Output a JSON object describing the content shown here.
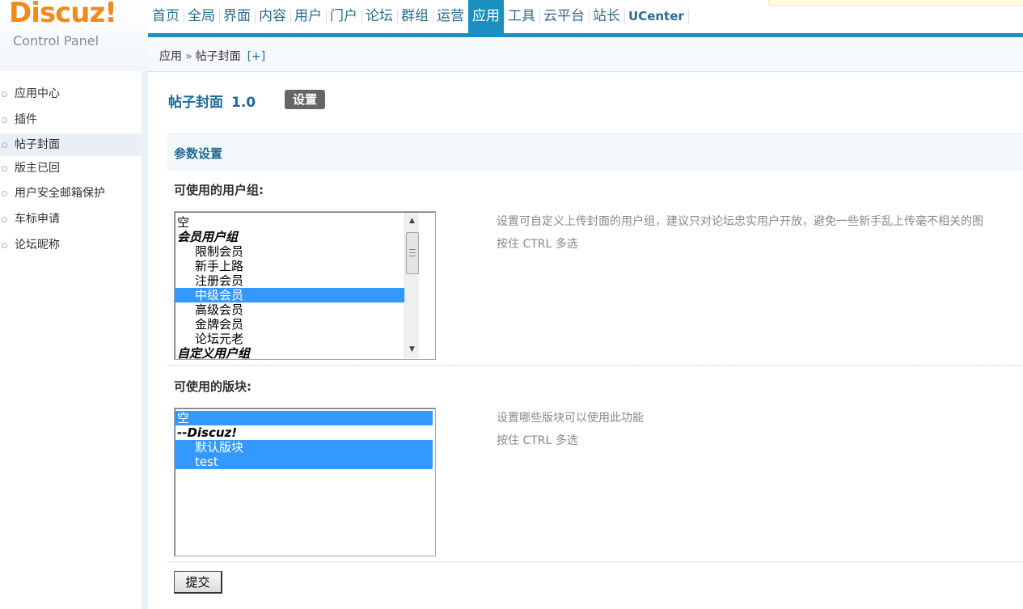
{
  "logo": {
    "brand": "Discuz",
    "bang": "!",
    "subtitle": "Control Panel"
  },
  "topnav": {
    "items": [
      {
        "label": "首页"
      },
      {
        "label": "全局"
      },
      {
        "label": "界面"
      },
      {
        "label": "内容"
      },
      {
        "label": "用户"
      },
      {
        "label": "门户"
      },
      {
        "label": "论坛"
      },
      {
        "label": "群组"
      },
      {
        "label": "运营"
      },
      {
        "label": "应用",
        "active": true
      },
      {
        "label": "工具"
      },
      {
        "label": "云平台"
      },
      {
        "label": "站长"
      },
      {
        "label": "UCenter"
      }
    ],
    "accent_color": "#1a8fc0"
  },
  "breadcrumb": {
    "root": "应用",
    "separator": "»",
    "current": "帖子封面",
    "add": "[+]"
  },
  "sidebar": {
    "items": [
      {
        "label": "应用中心"
      },
      {
        "label": "插件"
      },
      {
        "label": "帖子封面",
        "active": true
      },
      {
        "label": "版主已回"
      },
      {
        "label": "用户安全邮箱保护"
      },
      {
        "label": "车标申请"
      },
      {
        "label": "论坛昵称"
      }
    ]
  },
  "main": {
    "plugin_name": "帖子封面",
    "plugin_version": "1.0",
    "settings_tab": "设置",
    "section_title": "参数设置",
    "usergroups": {
      "label": "可使用的用户组:",
      "options": [
        {
          "text": "空",
          "type": "plain"
        },
        {
          "text": "会员用户组",
          "type": "group"
        },
        {
          "text": "限制会员",
          "type": "indent"
        },
        {
          "text": "新手上路",
          "type": "indent"
        },
        {
          "text": "注册会员",
          "type": "indent"
        },
        {
          "text": "中级会员",
          "type": "indent",
          "selected": true
        },
        {
          "text": "高级会员",
          "type": "indent"
        },
        {
          "text": "金牌会员",
          "type": "indent"
        },
        {
          "text": "论坛元老",
          "type": "indent"
        },
        {
          "text": "自定义用户组",
          "type": "group"
        }
      ],
      "hint_line1": "设置可自定义上传封面的用户组，建议只对论坛忠实用户开放，避免一些新手乱上传毫不相关的图",
      "hint_line2": "按住 CTRL 多选"
    },
    "forums": {
      "label": "可使用的版块:",
      "options": [
        {
          "text": "空",
          "type": "plain",
          "selected": true
        },
        {
          "text": "--Discuz!",
          "type": "group"
        },
        {
          "text": "默认版块",
          "type": "indent",
          "selected": true
        },
        {
          "text": "test",
          "type": "indent",
          "selected": true
        }
      ],
      "hint_line1": "设置哪些版块可以使用此功能",
      "hint_line2": "按住 CTRL 多选"
    },
    "submit_label": "提交"
  }
}
